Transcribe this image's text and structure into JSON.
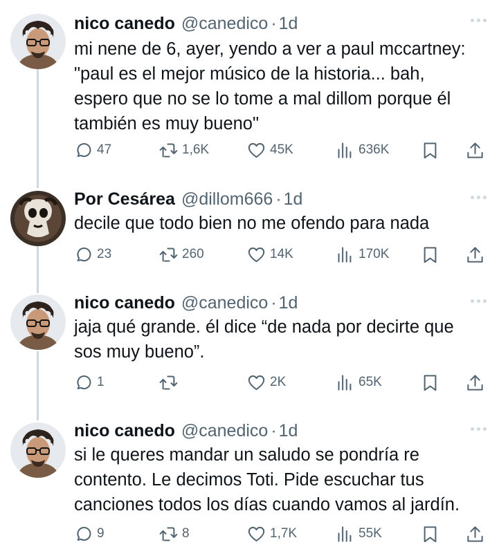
{
  "tweets": [
    {
      "name": "nico canedo",
      "handle": "@canedico",
      "separator": "·",
      "time": "1d",
      "text": "mi nene de 6, ayer, yendo a ver a paul mccartney:\n\"paul es el mejor músico de la historia... bah,\nespero que no se lo tome a mal dillom porque él\ntambién es muy bueno\"",
      "replies": "47",
      "retweets": "1,6K",
      "likes": "45K",
      "views": "636K",
      "avatar_icon": "man-with-glasses-avatar"
    },
    {
      "name": "Por Cesárea",
      "handle": "@dillom666",
      "separator": "·",
      "time": "1d",
      "text": "decile que todo bien no me ofendo para nada",
      "replies": "23",
      "retweets": "260",
      "likes": "14K",
      "views": "170K",
      "avatar_icon": "dark-character-avatar"
    },
    {
      "name": "nico canedo",
      "handle": "@canedico",
      "separator": "·",
      "time": "1d",
      "text": "jaja qué grande. él dice “de nada por decirte que\nsos muy bueno”.",
      "replies": "1",
      "retweets": "",
      "likes": "2K",
      "views": "65K",
      "avatar_icon": "man-with-glasses-avatar"
    },
    {
      "name": "nico canedo",
      "handle": "@canedico",
      "separator": "·",
      "time": "1d",
      "text": "si le queres mandar un saludo se pondría re\ncontento. Le decimos Toti. Pide escuchar tus\ncanciones todos los días cuando vamos al jardín.",
      "replies": "9",
      "retweets": "8",
      "likes": "1,7K",
      "views": "55K",
      "avatar_icon": "man-with-glasses-avatar"
    }
  ],
  "icons": {
    "reply": "speech-bubble-icon",
    "retweet": "retweet-arrows-icon",
    "like": "heart-icon",
    "views": "bar-chart-icon",
    "bookmark": "bookmark-icon",
    "share": "share-arrow-icon",
    "more": "more-dots-icon"
  },
  "colors": {
    "text": "#0f1419",
    "secondary": "#536471",
    "thread_line": "#cfd9de",
    "background": "#ffffff"
  }
}
